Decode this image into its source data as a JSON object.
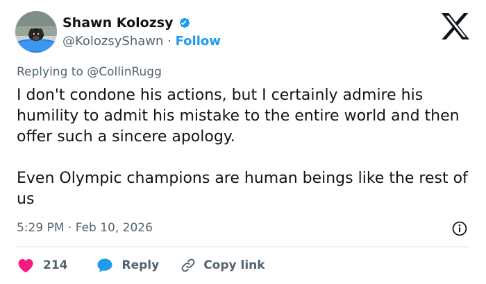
{
  "author": {
    "name": "Shawn Kolozsy",
    "handle": "@KolozsyShawn",
    "separator": "·",
    "follow_label": "Follow"
  },
  "reply_context": {
    "prefix": "Replying to",
    "mention": "@CollinRugg"
  },
  "tweet": {
    "paragraphs": [
      "I don't condone his actions, but I certainly admire his humility to admit his mistake to the entire world and then offer such a sincere apology.",
      "Even Olympic champions are human beings like the rest of us"
    ],
    "time": "5:29 PM",
    "separator": "·",
    "date": "Feb 10, 2026"
  },
  "actions": {
    "like_count": "214",
    "reply_label": "Reply",
    "copy_link_label": "Copy link"
  },
  "icons": {
    "verified": "verified-badge-icon",
    "brand": "x-logo-icon",
    "info": "info-icon",
    "like": "heart-icon",
    "reply": "reply-bubble-icon",
    "copy": "link-icon"
  },
  "colors": {
    "accent": "#1d9bf0",
    "like": "#f91880",
    "text": "#0f1419",
    "secondary": "#536471",
    "divider": "#cfd9de"
  }
}
